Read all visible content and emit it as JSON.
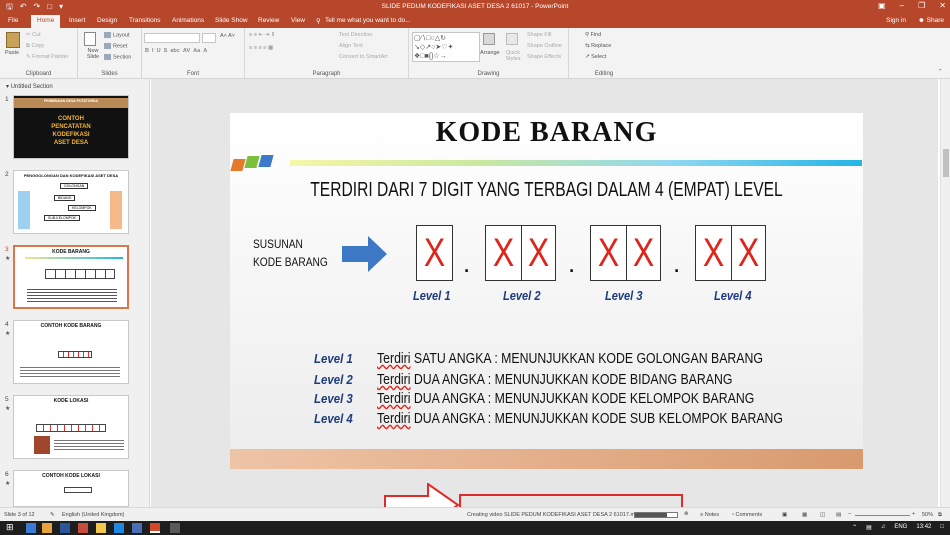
{
  "window": {
    "title": "SLIDE PEDUM KODEFIKASI ASET DESA 2 61017 - PowerPoint"
  },
  "tabs": [
    "File",
    "Home",
    "Insert",
    "Design",
    "Transitions",
    "Animations",
    "Slide Show",
    "Review",
    "View"
  ],
  "active_tab": "Home",
  "tell_me": "Tell me what you want to do...",
  "account": {
    "signin": "Sign in",
    "share": "Share"
  },
  "ribbon": {
    "clipboard": {
      "paste": "Paste",
      "cut": "Cut",
      "copy": "Copy",
      "format_painter": "Format Painter",
      "label": "Clipboard"
    },
    "slides": {
      "new_slide": "New Slide",
      "layout": "Layout",
      "reset": "Reset",
      "section": "Section",
      "label": "Slides"
    },
    "font": {
      "label": "Font"
    },
    "paragraph": {
      "text_direction": "Text Direction",
      "align_text": "Align Text",
      "smartart": "Convert to SmartArt",
      "label": "Paragraph"
    },
    "drawing": {
      "arrange": "Arrange",
      "quick_styles": "Quick Styles",
      "shape_fill": "Shape Fill",
      "shape_outline": "Shape Outline",
      "shape_effects": "Shape Effects",
      "label": "Drawing"
    },
    "editing": {
      "find": "Find",
      "replace": "Replace",
      "select": "Select",
      "label": "Editing"
    }
  },
  "section_name": "Untitled Section",
  "thumbnails": [
    {
      "num": "1",
      "header": "PEMBINAAN DESA PUTATORDA",
      "lines": [
        "CONTOH",
        "PENCATATAN",
        "KODEFIKASI",
        "ASET DESA"
      ]
    },
    {
      "num": "2",
      "title": "PENGGOLONGAN DAN KODEFIKASI ASET DESA",
      "labels": [
        "GOLONGAN",
        "BIDANG",
        "KELOMPOK",
        "SUB-KELOMPOK"
      ]
    },
    {
      "num": "3",
      "title": "KODE BARANG"
    },
    {
      "num": "4",
      "title": "CONTOH KODE BARANG"
    },
    {
      "num": "5",
      "title": "KODE LOKASI"
    },
    {
      "num": "6",
      "title": "CONTOH KODE LOKASI"
    }
  ],
  "slide": {
    "title": "KODE BARANG",
    "subtitle": "TERDIRI DARI 7 DIGIT YANG TERBAGI DALAM 4 (EMPAT) LEVEL",
    "susunan": [
      "SUSUNAN",
      "KODE BARANG"
    ],
    "digit_char": "X",
    "dot_char": ".",
    "levels": [
      "Level 1",
      "Level 2",
      "Level 3",
      "Level 4"
    ],
    "rows": [
      {
        "level": "Level 1",
        "prefix": "Terdiri",
        "text": " SATU ANGKA :  MENUNJUKKAN KODE GOLONGAN BARANG"
      },
      {
        "level": "Level 2",
        "prefix": "Terdiri",
        "text": " DUA ANGKA   :  MENUNJUKKAN KODE BIDANG BARANG"
      },
      {
        "level": "Level 3",
        "prefix": "Terdiri",
        "text": " DUA ANGKA   :  MENUNJUKKAN KODE KELOMPOK BARANG"
      },
      {
        "level": "Level 4",
        "prefix": "Terdiri",
        "text": " DUA ANGKA   :  MENUNJUKKAN KODE SUB KELOMPOK BARANG"
      }
    ]
  },
  "status": {
    "slide_of": "Slide 3 of 12",
    "language": "English (United Kingdom)",
    "creating_video": "Creating video SLIDE PEDUM KODEFIKASI ASET DESA 2 61017.mp4",
    "progress": 0.75,
    "notes": "Notes",
    "comments": "Comments",
    "zoom": "50%"
  },
  "taskbar": {
    "lang": "ENG",
    "time": "13:42"
  },
  "colors": {
    "accent": "#b7472a",
    "digit_red": "#e0241b",
    "level_blue": "#1d3b7e",
    "highlight_red": "#e02b2b"
  }
}
